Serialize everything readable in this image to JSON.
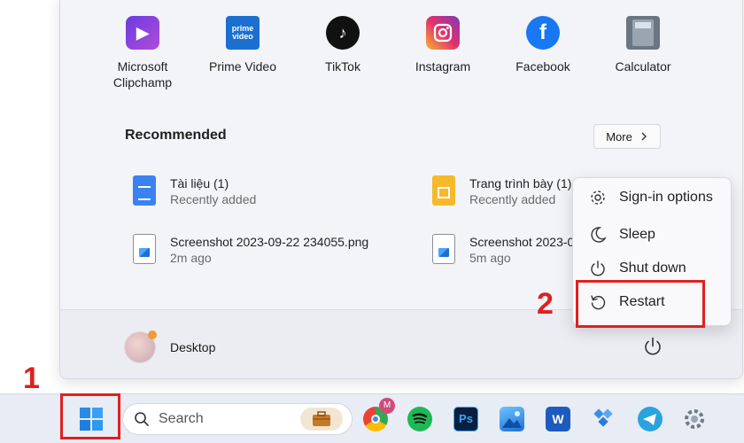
{
  "pinned_apps": [
    {
      "label_line1": "Microsoft",
      "label_line2": "Clipchamp",
      "icon": "clipchamp-icon"
    },
    {
      "label_line1": "Prime Video",
      "label_line2": "",
      "icon": "prime-video-icon",
      "icon_text": "prime video"
    },
    {
      "label_line1": "TikTok",
      "label_line2": "",
      "icon": "tiktok-icon",
      "icon_text": "♪"
    },
    {
      "label_line1": "Instagram",
      "label_line2": "",
      "icon": "instagram-icon"
    },
    {
      "label_line1": "Facebook",
      "label_line2": "",
      "icon": "facebook-icon",
      "icon_text": "f"
    },
    {
      "label_line1": "Calculator",
      "label_line2": "",
      "icon": "calculator-icon"
    }
  ],
  "recommended": {
    "title": "Recommended",
    "more_label": "More",
    "items": [
      {
        "name": "Tài liệu (1)",
        "sub": "Recently added",
        "icon": "google-docs-icon"
      },
      {
        "name": "Trang trình bày (1)",
        "sub": "Recently added",
        "icon": "google-slides-icon"
      },
      {
        "name": "Screenshot 2023-09-22 234055.png",
        "sub": "2m ago",
        "icon": "image-file-icon"
      },
      {
        "name": "Screenshot 2023-0",
        "sub": "5m ago",
        "icon": "image-file-icon"
      }
    ]
  },
  "user": {
    "name": "Desktop"
  },
  "power_menu": {
    "items": [
      {
        "label": "Sign-in options",
        "icon": "gear-icon"
      },
      {
        "label": "Sleep",
        "icon": "moon-icon"
      },
      {
        "label": "Shut down",
        "icon": "power-icon"
      },
      {
        "label": "Restart",
        "icon": "restart-icon"
      }
    ]
  },
  "annotations": {
    "step1": "1",
    "step2": "2",
    "color": "#e02020"
  },
  "taskbar": {
    "search_placeholder": "Search",
    "badge_text": "M",
    "apps": [
      "start-icon",
      "work-icon",
      "chrome-icon",
      "spotify-icon",
      "photoshop-icon",
      "photos-icon",
      "word-icon",
      "azure-icon",
      "telegram-icon",
      "settings-icon"
    ]
  }
}
